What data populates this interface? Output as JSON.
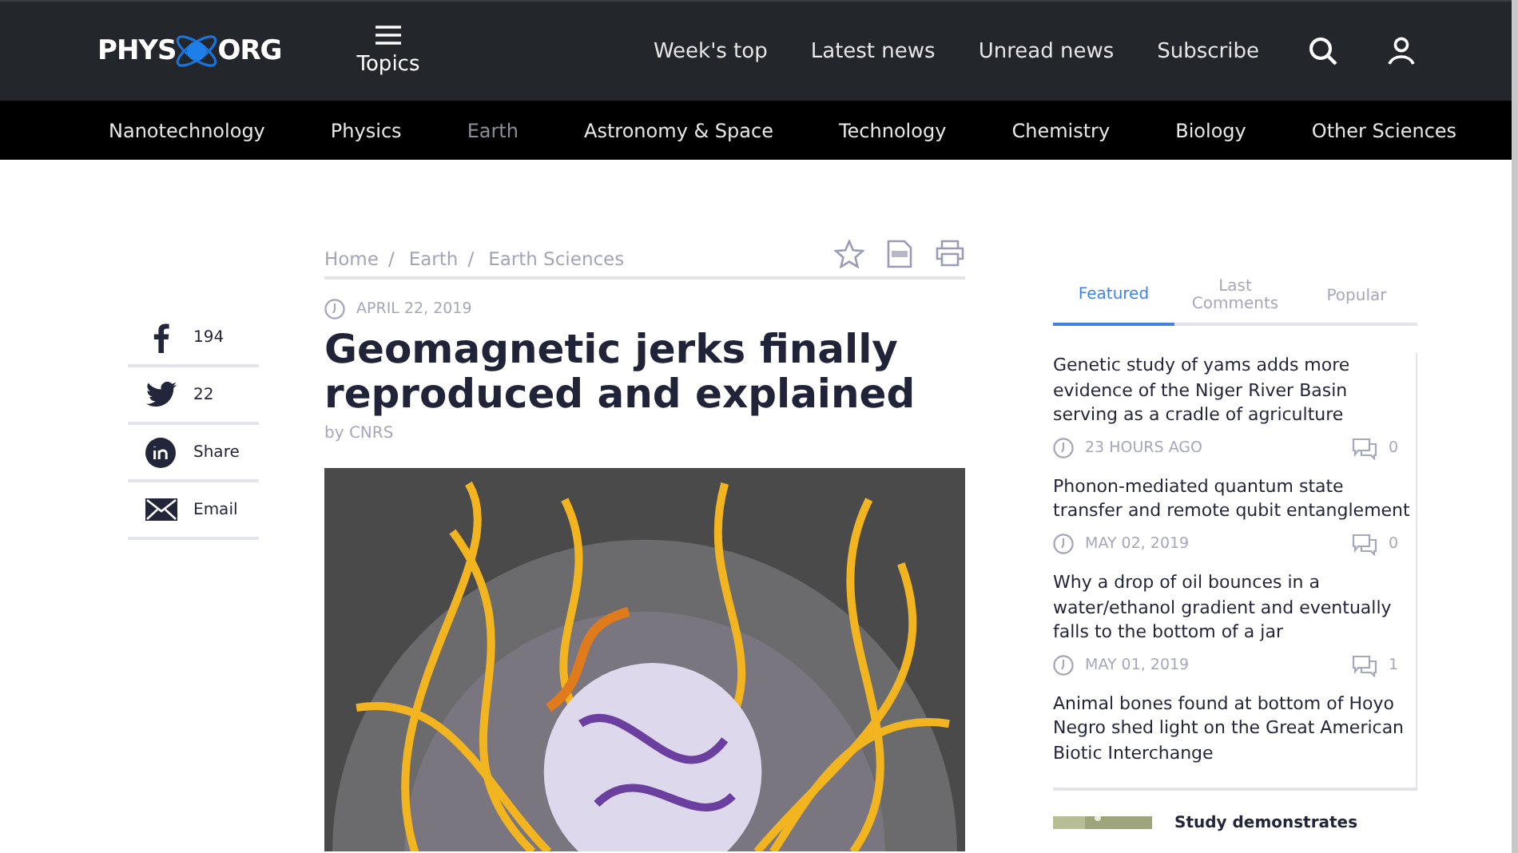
{
  "logo": {
    "left": "PHYS",
    "right": "ORG"
  },
  "topics_button": {
    "label": "Topics"
  },
  "header_links": [
    "Week's top",
    "Latest news",
    "Unread news",
    "Subscribe"
  ],
  "categories": [
    {
      "label": "Nanotechnology",
      "selected": false
    },
    {
      "label": "Physics",
      "selected": false
    },
    {
      "label": "Earth",
      "selected": true
    },
    {
      "label": "Astronomy & Space",
      "selected": false
    },
    {
      "label": "Technology",
      "selected": false
    },
    {
      "label": "Chemistry",
      "selected": false
    },
    {
      "label": "Biology",
      "selected": false
    },
    {
      "label": "Other Sciences",
      "selected": false
    }
  ],
  "breadcrumbs": {
    "separator": "/",
    "items": [
      "Home",
      "Earth",
      "Earth Sciences"
    ]
  },
  "share": [
    {
      "kind": "facebook",
      "label": "194"
    },
    {
      "kind": "twitter",
      "label": "22"
    },
    {
      "kind": "linkedin",
      "label": "Share"
    },
    {
      "kind": "email",
      "label": "Email"
    }
  ],
  "article": {
    "date": "APRIL 22, 2019",
    "title": "Geomagnetic jerks finally reproduced and explained",
    "byline": "by CNRS"
  },
  "sidebar": {
    "tabs": [
      {
        "label": "Featured",
        "selected": true
      },
      {
        "label": "Last Comments",
        "selected": false
      },
      {
        "label": "Popular",
        "selected": false
      }
    ],
    "stories": [
      {
        "title": "Genetic study of yams adds more evidence of the Niger River Basin serving as a cradle of agriculture",
        "date": "23 HOURS AGO",
        "comments": "0"
      },
      {
        "title": "Phonon-mediated quantum state transfer and remote qubit entanglement",
        "date": "MAY 02, 2019",
        "comments": "0"
      },
      {
        "title": "Why a drop of oil bounces in a water/ethanol gradient and eventually falls to the bottom of a jar",
        "date": "MAY 01, 2019",
        "comments": "1"
      },
      {
        "title": "Animal bones found at bottom of Hoyo Negro shed light on the Great American Biotic Interchange"
      }
    ],
    "next_story": {
      "title": "Study demonstrates"
    }
  }
}
